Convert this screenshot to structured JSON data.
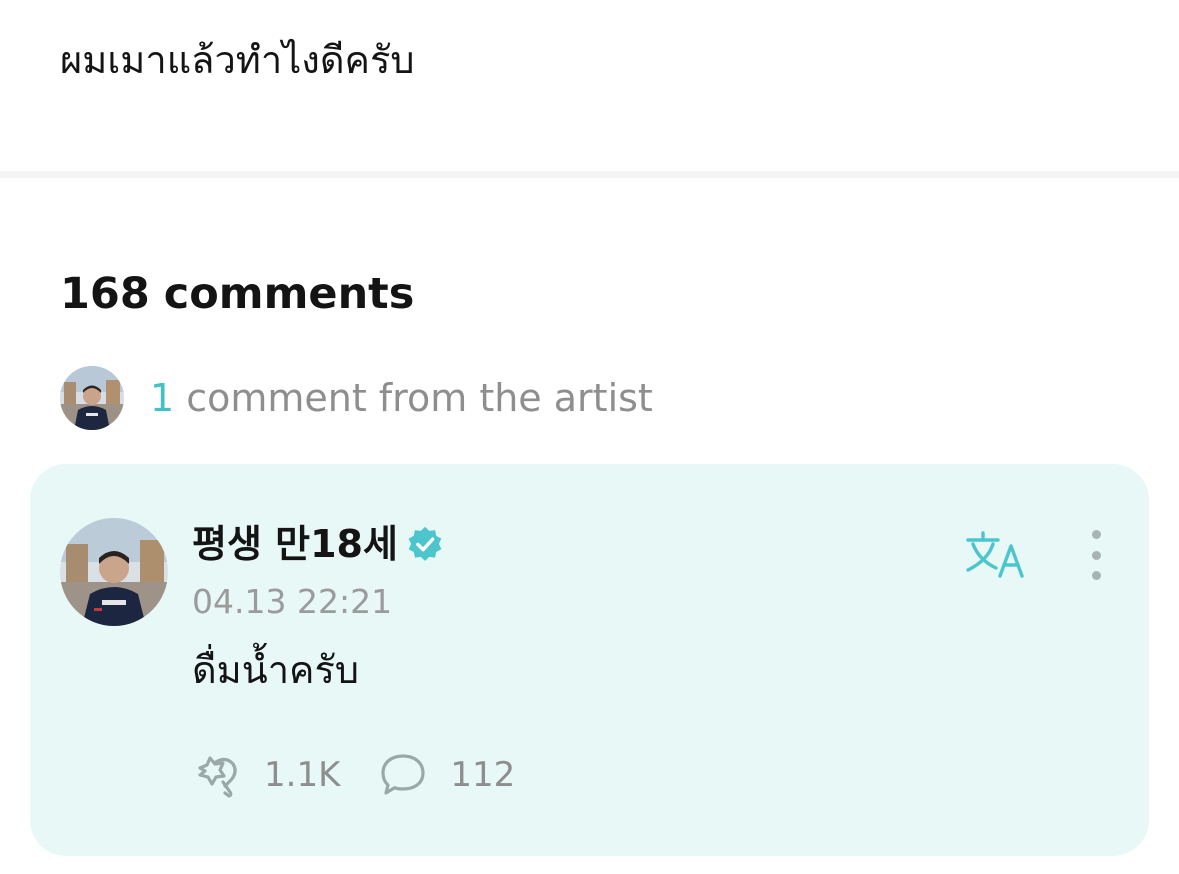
{
  "post": {
    "text": "ผมเมาแล้วทำไงดีครับ"
  },
  "comments_header": {
    "count": "168",
    "label": "comments"
  },
  "artist_summary": {
    "count": "1",
    "label": "comment from the artist"
  },
  "comment": {
    "author": "평생 만18세",
    "timestamp": "04.13 22:21",
    "text": "ดื่มน้ำครับ",
    "likes": "1.1K",
    "replies": "112"
  },
  "colors": {
    "accent": "#3fc1c9",
    "card_background": "#e7f8f6",
    "muted_text": "#8e8e8e"
  },
  "icons": {
    "verified": "verified-badge-icon",
    "translate": "translate-icon",
    "more": "more-vertical-icon",
    "like": "like-icon",
    "reply": "comment-bubble-icon"
  }
}
